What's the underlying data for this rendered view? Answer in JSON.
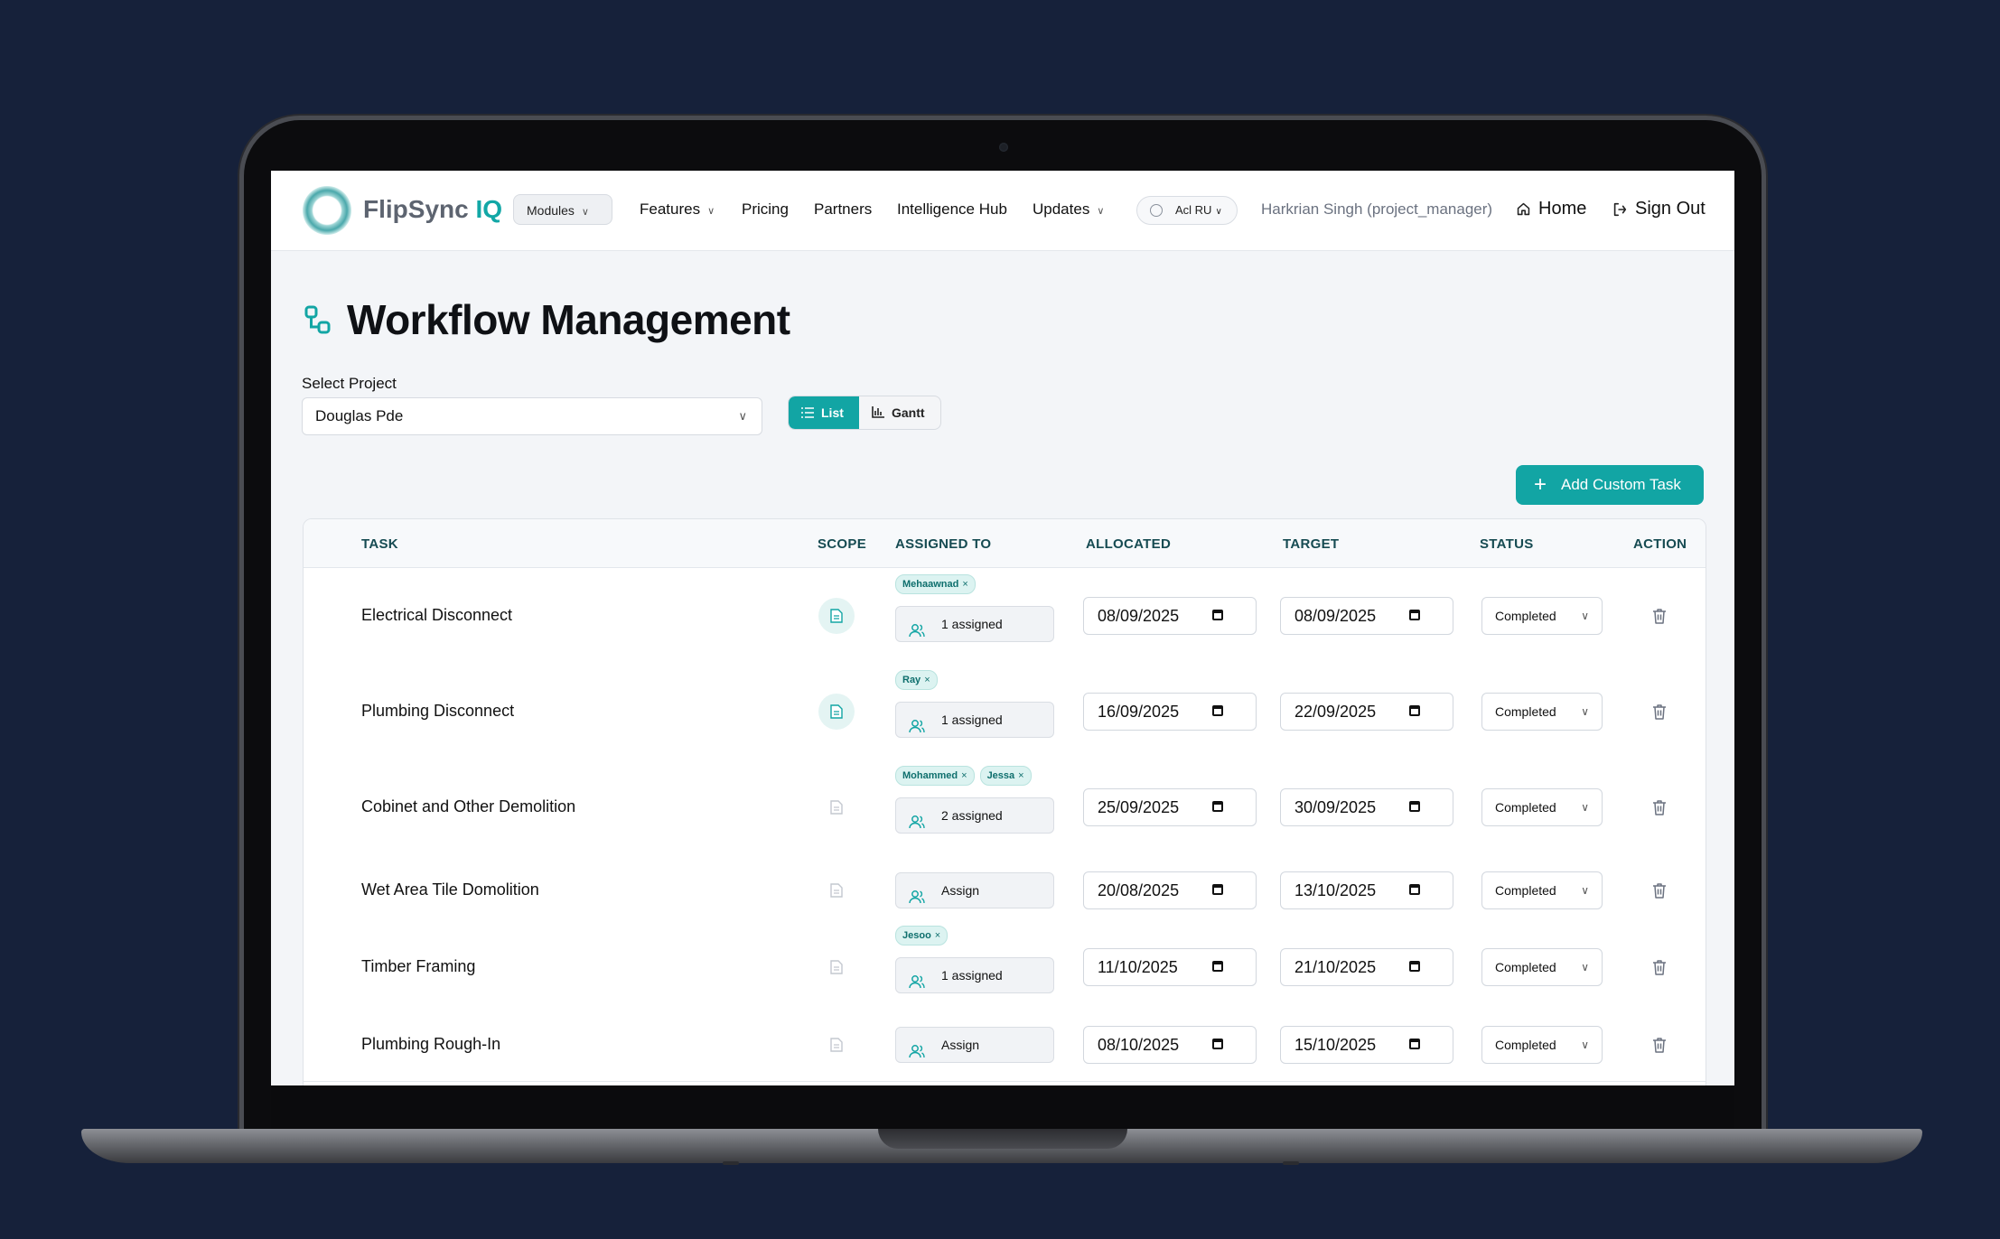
{
  "app": {
    "brand_name": "FlipSync",
    "brand_suffix": "IQ",
    "accent_color": "#12a5a4"
  },
  "nav": {
    "modules_label": "Modules",
    "items": [
      "Features",
      "Pricing",
      "Partners",
      "Intelligence Hub",
      "Updates"
    ],
    "language_label": "Acl RU",
    "user_label": "Harkrian Singh (project_manager)",
    "home_label": "Home",
    "signout_label": "Sign Out"
  },
  "page": {
    "title": "Workflow Management",
    "select_label": "Select Project",
    "selected_project": "Douglas Pde",
    "view_list_label": "List",
    "view_gantt_label": "Gantt",
    "active_view": "List",
    "add_task_label": "Add Custom Task"
  },
  "table": {
    "columns": [
      "TASK",
      "SCOPE",
      "ASSIGNED TO",
      "ALLOCATED",
      "TARGET",
      "STATUS",
      "ACTION"
    ],
    "rows": [
      {
        "task": "Electrical Disconnect",
        "scope_active": true,
        "assignees": [
          "Mehaawnad"
        ],
        "assign_label": "1 assigned",
        "allocated": "08/09/2025",
        "target": "08/09/2025",
        "status": "Completed"
      },
      {
        "task": "Plumbing Disconnect",
        "scope_active": true,
        "assignees": [
          "Ray"
        ],
        "assign_label": "1 assigned",
        "allocated": "16/09/2025",
        "target": "22/09/2025",
        "status": "Completed"
      },
      {
        "task": "Cobinet and Other Demolition",
        "scope_active": false,
        "assignees": [
          "Mohammed",
          "Jessa"
        ],
        "assign_label": "2 assigned",
        "allocated": "25/09/2025",
        "target": "30/09/2025",
        "status": "Completed"
      },
      {
        "task": "Wet Area Tile Domolition",
        "scope_active": false,
        "assignees": [],
        "assign_label": "Assign",
        "allocated": "20/08/2025",
        "target": "13/10/2025",
        "status": "Completed"
      },
      {
        "task": "Timber Framing",
        "scope_active": false,
        "assignees": [
          "Jesoo"
        ],
        "assign_label": "1 assigned",
        "allocated": "11/10/2025",
        "target": "21/10/2025",
        "status": "Completed"
      },
      {
        "task": "Plumbing Rough-In",
        "scope_active": false,
        "assignees": [],
        "assign_label": "Assign",
        "allocated": "08/10/2025",
        "target": "15/10/2025",
        "status": "Completed"
      }
    ]
  }
}
